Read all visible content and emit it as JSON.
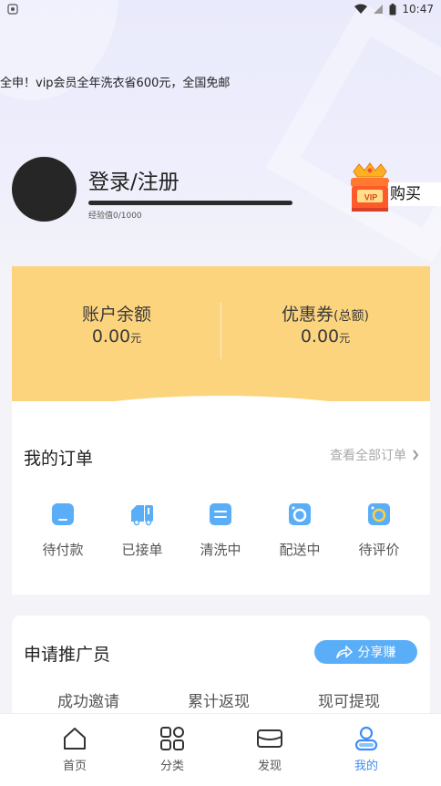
{
  "status_bar": {
    "time": "10:47"
  },
  "marquee": {
    "text": "全申！vip会员全年洗衣省600元，全国免邮"
  },
  "profile": {
    "login_label": "登录/注册",
    "exp_text": "经验值0/1000",
    "buy_label": "购买",
    "vip_badge": "VIP"
  },
  "balance": {
    "account_label": "账户余额",
    "account_value": "0.00",
    "account_unit": "元",
    "coupon_label": "优惠券",
    "coupon_sub": "(总额)",
    "coupon_value": "0.00",
    "coupon_unit": "元"
  },
  "orders": {
    "title": "我的订单",
    "view_all": "查看全部订单",
    "items": [
      {
        "label": "待付款",
        "icon": "wallet-icon"
      },
      {
        "label": "已接单",
        "icon": "truck-icon"
      },
      {
        "label": "清洗中",
        "icon": "washer-icon"
      },
      {
        "label": "配送中",
        "icon": "delivery-icon"
      },
      {
        "label": "待评价",
        "icon": "review-icon"
      }
    ]
  },
  "promoter": {
    "title": "申请推广员",
    "share_label": "分享赚",
    "stats": [
      "成功邀请",
      "累计返现",
      "现可提现"
    ]
  },
  "tabbar": {
    "items": [
      {
        "label": "首页",
        "icon": "home-icon"
      },
      {
        "label": "分类",
        "icon": "grid-icon"
      },
      {
        "label": "发现",
        "icon": "box-icon"
      },
      {
        "label": "我的",
        "icon": "person-icon"
      }
    ],
    "active_color": "#3f8ef5"
  },
  "colors": {
    "balance_card": "#fdd47e",
    "accent": "#5aaef8"
  }
}
